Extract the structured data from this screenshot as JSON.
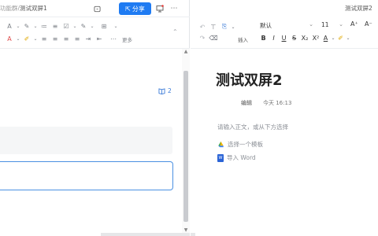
{
  "left": {
    "breadcrumb_path": "功能群/",
    "breadcrumb_doc": "测试双屏1",
    "share_label": "分享",
    "more_label": "更多",
    "comment_count": "2",
    "toolbar_row1": [
      "A",
      "∨",
      "✎",
      "∨",
      "≡",
      "≡",
      "☑",
      "∨",
      "✎",
      "∨",
      "⊞",
      "∨"
    ],
    "toolbar_row2": [
      "A",
      "∨",
      "✐",
      "∨",
      "≡",
      "≡",
      "≡",
      "≡",
      "≡",
      "≡",
      "⊟",
      "⋯"
    ]
  },
  "right": {
    "window_title": "测试双屏2",
    "font_name": "默认",
    "font_size": "11",
    "insert_label": "插入",
    "doc_title": "测试双屏2",
    "editor_label": "编辑",
    "edit_time": "今天 16:13",
    "hint": "请输入正文，或从下方选择",
    "option_template": "选择一个模板",
    "option_import": "导入 Word"
  },
  "colors": {
    "accent": "#1f7bf2",
    "focus_border": "#4a90e2",
    "link": "#3b7bd8"
  }
}
